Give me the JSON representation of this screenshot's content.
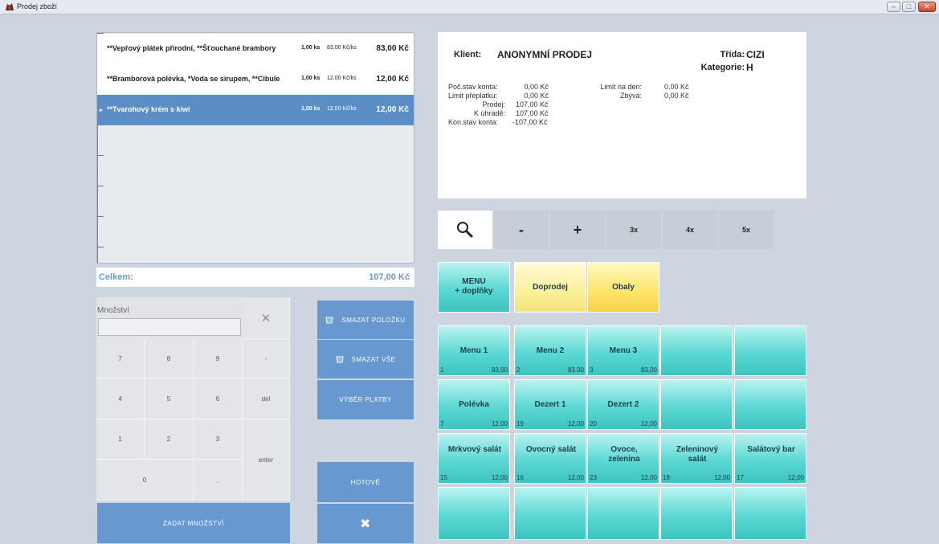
{
  "window": {
    "title": "Prodej zboží",
    "controls": [
      "–",
      "□",
      "✕"
    ]
  },
  "order": {
    "items": [
      {
        "name": "**Vepřový plátek přírodní, **Šťouchané brambory",
        "qty": "1,00 ks",
        "unit_price": "83,00 Kč/ks",
        "total": "83,00 Kč",
        "selected": false
      },
      {
        "name": "**Bramborová polévka, *Voda se sirupem, **Cibule",
        "qty": "1,00 ks",
        "unit_price": "12,00 Kč/ks",
        "total": "12,00 Kč",
        "selected": false
      },
      {
        "name": "**Tvarohový krém s kiwi",
        "qty": "1,00 ks",
        "unit_price": "12,00 Kč/ks",
        "total": "12,00 Kč",
        "selected": true
      }
    ],
    "selected_marker": "▸",
    "total_label": "Celkem:",
    "total_value": "107,00 Kč"
  },
  "keypad": {
    "qty_label": "Množství",
    "qty_value": "",
    "clear": "✕",
    "keys": [
      "7",
      "8",
      "9",
      "-",
      "4",
      "5",
      "6",
      "del",
      "1",
      "2",
      "3",
      "enter",
      "0",
      ","
    ],
    "submit": "ZADAT MNOŽSTVÍ"
  },
  "actions": {
    "delete_item": "SMAZAT  POLOŽKU",
    "delete_all": "SMAZAT  VŠE",
    "payment": "VÝBĚR PLATBY",
    "done": "HOTOVĚ",
    "cancel": "✖",
    "basket_icon": "trash-basket-icon"
  },
  "client": {
    "client_label": "Klient:",
    "client_name": "ANONYMNÍ PRODEJ",
    "class_label": "Třída:",
    "class_value": "CIZI",
    "category_label": "Kategorie:",
    "category_value": "H",
    "balance_start_label": "Poč.stav konta:",
    "balance_start": "0,00 Kč",
    "overpay_limit_label": "Limit přeplatku:",
    "overpay_limit": "0,00 Kč",
    "sale_label": "Prodej:",
    "sale": "107,00 Kč",
    "to_pay_label": "K úhradě:",
    "to_pay": "107,00 Kč",
    "balance_end_label": "Kon.stav konta:",
    "balance_end": "-107,00 Kč",
    "daily_limit_label": "Limit na den:",
    "daily_limit": "0,00 Kč",
    "remaining_label": "Zbývá:",
    "remaining": "0,00 Kč"
  },
  "toolbar": {
    "search_icon": "search-icon",
    "minus": "-",
    "plus": "+",
    "x3": "3x",
    "x4": "4x",
    "x5": "5x"
  },
  "categories": {
    "menu_line1": "MENU",
    "menu_line2": "+ doplňky",
    "sale_out": "Doprodej",
    "packaging": "Obaly"
  },
  "products": [
    {
      "name": "Menu 1",
      "code": "1",
      "price": "83,00"
    },
    {
      "name": "Menu 2",
      "code": "2",
      "price": "83,00"
    },
    {
      "name": "Menu 3",
      "code": "3",
      "price": "83,00"
    },
    {
      "name": "Polévka",
      "code": "7",
      "price": "12,00"
    },
    {
      "name": "Dezert 1",
      "code": "19",
      "price": "12,00"
    },
    {
      "name": "Dezert 2",
      "code": "20",
      "price": "12,00"
    },
    {
      "name": "Mrkvový salát",
      "code": "15",
      "price": "12,00"
    },
    {
      "name": "Ovocný salát",
      "code": "16",
      "price": "12,00"
    },
    {
      "name": "Ovoce, zelenina",
      "code": "23",
      "price": "12,00"
    },
    {
      "name": "Zeleninový salát",
      "code": "18",
      "price": "12,00"
    },
    {
      "name": "Salátový bar",
      "code": "17",
      "price": "12,00"
    }
  ],
  "colors": {
    "accent_blue": "#6798d0",
    "selected_row": "#5b8ec4",
    "tile_teal": "#5bd8d3",
    "tile_yellow": "#fde56a"
  }
}
